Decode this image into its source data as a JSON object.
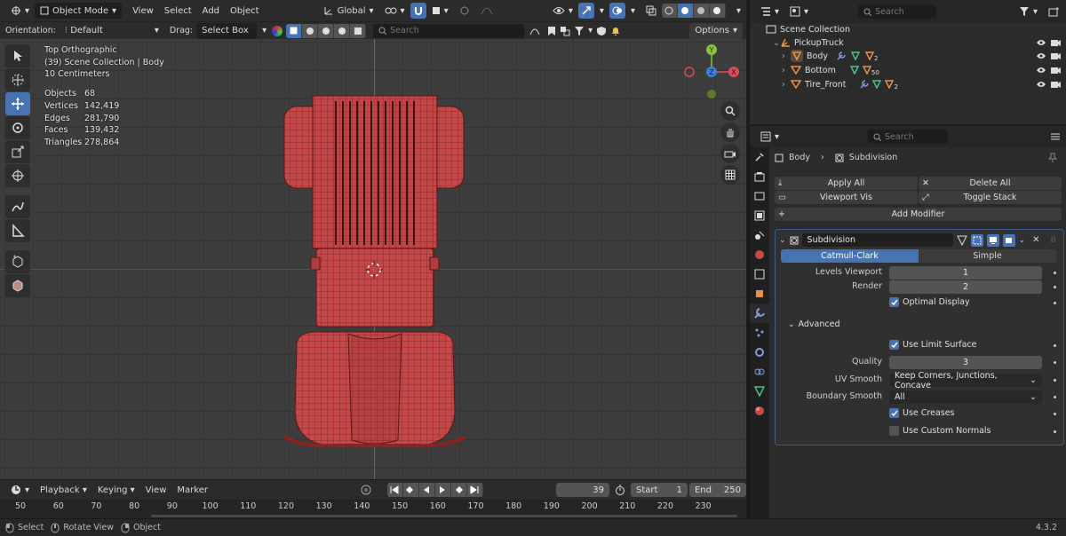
{
  "colors": {
    "accent": "#4772b3",
    "mesh": "#c04848",
    "x_axis": "#e04a5a",
    "y_axis": "#8cbf3c",
    "z_axis": "#3e7ede",
    "panel": "#2b2b2b"
  },
  "viewport_header": {
    "mode": "Object Mode",
    "menus": [
      "View",
      "Select",
      "Add",
      "Object"
    ],
    "transform_orientation": "Global"
  },
  "tool_header": {
    "orientation_label": "Orientation:",
    "orientation_value": "Default",
    "drag_label": "Drag:",
    "drag_value": "Select Box",
    "search_placeholder": "Search",
    "options_label": "Options"
  },
  "overlay": {
    "view_name": "Top Orthographic",
    "context": "(39) Scene Collection | Body",
    "scale": "10 Centimeters",
    "stats": [
      {
        "key": "Objects",
        "value": "68"
      },
      {
        "key": "Vertices",
        "value": "142,419"
      },
      {
        "key": "Edges",
        "value": "281,790"
      },
      {
        "key": "Faces",
        "value": "139,432"
      },
      {
        "key": "Triangles",
        "value": "278,864"
      }
    ]
  },
  "gizmo": {
    "y_label": "Y",
    "x_label": "X",
    "z_label": "Z"
  },
  "timeline": {
    "menus": [
      "Playback",
      "Keying",
      "View",
      "Marker"
    ],
    "current_frame": "39",
    "start_label": "Start",
    "start_value": "1",
    "end_label": "End",
    "end_value": "250",
    "ruler_ticks": [
      "50",
      "60",
      "70",
      "80",
      "90",
      "100",
      "110",
      "120",
      "130",
      "140",
      "150",
      "160",
      "170",
      "180",
      "190",
      "200",
      "210",
      "220",
      "230"
    ]
  },
  "statusbar": {
    "items": [
      "Select",
      "Rotate View",
      "Object"
    ],
    "version": "4.3.2"
  },
  "outliner": {
    "search_placeholder": "Search",
    "scene_collection": "Scene Collection",
    "root_object": "PickupTruck",
    "children": [
      {
        "name": "Body",
        "subscript": "2"
      },
      {
        "name": "Bottom",
        "subscript": "50"
      },
      {
        "name": "Tire_Front",
        "subscript": "2"
      }
    ]
  },
  "properties": {
    "search_placeholder": "Search",
    "breadcrumb_object": "Body",
    "breadcrumb_modifier": "Subdivision",
    "apply_all": "Apply All",
    "delete_all": "Delete All",
    "viewport_vis": "Viewport Vis",
    "toggle_stack": "Toggle Stack",
    "add_modifier": "Add Modifier",
    "modifier": {
      "name": "Subdivision",
      "type_options": [
        "Catmull-Clark",
        "Simple"
      ],
      "selected_type": "Catmull-Clark",
      "levels_viewport_label": "Levels Viewport",
      "levels_viewport_value": "1",
      "render_label": "Render",
      "render_value": "2",
      "optimal_display": "Optimal Display",
      "advanced_label": "Advanced",
      "use_limit_surface": "Use Limit Surface",
      "quality_label": "Quality",
      "quality_value": "3",
      "uv_smooth_label": "UV Smooth",
      "uv_smooth_value": "Keep Corners, Junctions, Concave",
      "boundary_smooth_label": "Boundary Smooth",
      "boundary_smooth_value": "All",
      "use_creases": "Use Creases",
      "use_custom_normals": "Use Custom Normals"
    }
  }
}
